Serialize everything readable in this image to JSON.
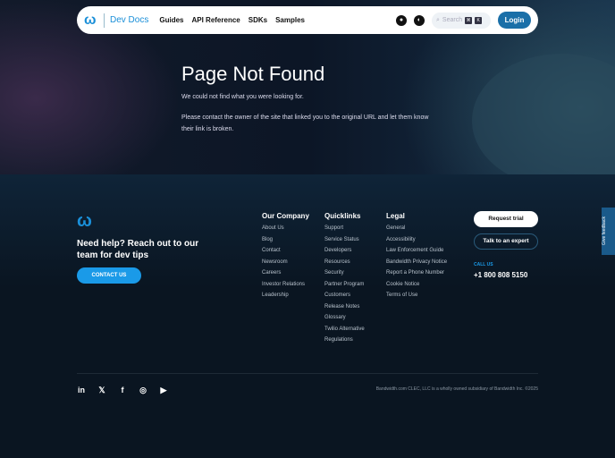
{
  "nav": {
    "brand": "Dev Docs",
    "links": [
      "Guides",
      "API Reference",
      "SDKs",
      "Samples"
    ],
    "search_placeholder": "Search",
    "kbd": [
      "⌘",
      "K"
    ],
    "login": "Login"
  },
  "main": {
    "title": "Page Not Found",
    "line1": "We could not find what you were looking for.",
    "line2": "Please contact the owner of the site that linked you to the original URL and let them know their link is broken."
  },
  "footer": {
    "help": "Need help? Reach out to our team for dev tips",
    "contact_us": "CONTACT US",
    "columns": [
      {
        "title": "Our Company",
        "items": [
          "About Us",
          "Blog",
          "Contact",
          "Newsroom",
          "Careers",
          "Investor Relations",
          "Leadership"
        ]
      },
      {
        "title": "Quicklinks",
        "items": [
          "Support",
          "Service Status",
          "Developers",
          "Resources",
          "Security",
          "Partner Program",
          "Customers",
          "Release Notes",
          "Glossary",
          "Twilio Alternative",
          "Regulations"
        ]
      },
      {
        "title": "Legal",
        "items": [
          "General",
          "Accessibility",
          "Law Enforcement Guide",
          "Bandwidth Privacy Notice",
          "Report a Phone Number",
          "Cookie Notice",
          "Terms of Use"
        ]
      }
    ],
    "request_trial": "Request trial",
    "talk_expert": "Talk to an expert",
    "call_us": "CALL US",
    "phone": "+1 800 808 5150",
    "feedback": "Give feedback",
    "copyright": "Bandwidth.com CLEC, LLC is a wholly owned subsidiary of Bandwidth Inc. ©2025"
  }
}
